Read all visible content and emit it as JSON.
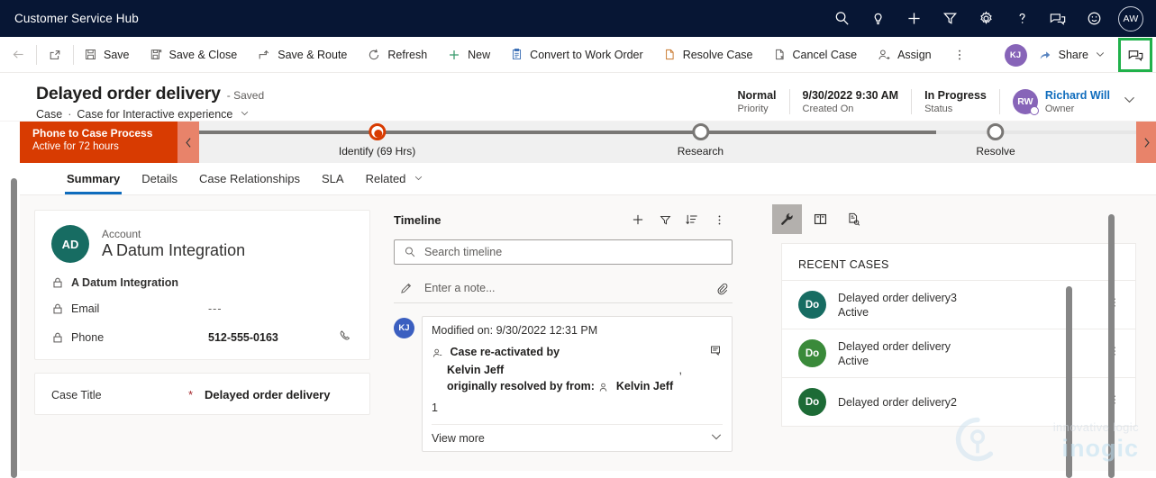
{
  "appbar": {
    "title": "Customer Service Hub",
    "icons": [
      "search-icon",
      "lightbulb-icon",
      "plus-icon",
      "filter-icon",
      "gear-icon",
      "help-icon",
      "feedback-icon",
      "smiley-icon"
    ],
    "avatar_initials": "AW"
  },
  "commandbar": {
    "back_label": "Back",
    "popout_label": "Open in new window",
    "items": [
      {
        "label": "Save",
        "icon": "save-icon"
      },
      {
        "label": "Save & Close",
        "icon": "save-close-icon"
      },
      {
        "label": "Save & Route",
        "icon": "save-route-icon"
      },
      {
        "label": "Refresh",
        "icon": "refresh-icon"
      },
      {
        "label": "New",
        "icon": "plus-icon"
      },
      {
        "label": "Convert to Work Order",
        "icon": "clipboard-icon"
      },
      {
        "label": "Resolve Case",
        "icon": "page-icon"
      },
      {
        "label": "Cancel Case",
        "icon": "page-x-icon"
      },
      {
        "label": "Assign",
        "icon": "person-assign-icon"
      }
    ],
    "overflow_label": "More commands",
    "user_initials": "KJ",
    "share_label": "Share",
    "highlighted_icon": "feedback-icon",
    "highlight_color": "#20b14a"
  },
  "record": {
    "title": "Delayed order delivery",
    "saved_state": "- Saved",
    "entity": "Case",
    "separator": "·",
    "form_name": "Case for Interactive experience",
    "fields": [
      {
        "value": "Normal",
        "label": "Priority"
      },
      {
        "value": "9/30/2022 9:30 AM",
        "label": "Created On"
      },
      {
        "value": "In Progress",
        "label": "Status"
      }
    ],
    "owner": {
      "initials": "RW",
      "name": "Richard Will",
      "label": "Owner"
    }
  },
  "bpf": {
    "name": "Phone to Case Process",
    "active_for": "Active for 72 hours",
    "prev_label": "Previous stage",
    "next_label": "Next stage",
    "stages": [
      {
        "label": "Identify",
        "duration": "(69 Hrs)",
        "active": true
      },
      {
        "label": "Research",
        "duration": "",
        "active": false
      },
      {
        "label": "Resolve",
        "duration": "",
        "active": false
      }
    ]
  },
  "tabs": [
    {
      "label": "Summary",
      "selected": true
    },
    {
      "label": "Details",
      "selected": false
    },
    {
      "label": "Case Relationships",
      "selected": false
    },
    {
      "label": "SLA",
      "selected": false
    },
    {
      "label": "Related",
      "selected": false,
      "has_caret": true
    }
  ],
  "account_card": {
    "initials": "AD",
    "kind": "Account",
    "name": "A Datum Integration",
    "rows": [
      {
        "label": "A Datum Integration",
        "value": "",
        "strong_label": true
      },
      {
        "label": "Email",
        "value": "---",
        "dim": true
      },
      {
        "label": "Phone",
        "value": "512-555-0163",
        "call_icon": "phone-icon"
      }
    ]
  },
  "case_title_field": {
    "label": "Case Title",
    "required": "*",
    "value": "Delayed order delivery"
  },
  "timeline": {
    "title": "Timeline",
    "actions": [
      "plus-icon",
      "filter-icon",
      "sort-icon",
      "more-icon"
    ],
    "search_placeholder": "Search timeline",
    "note_placeholder": "Enter a note...",
    "attach_icon": "paperclip-icon",
    "entry": {
      "initials": "KJ",
      "modified_on": "Modified on: 9/30/2022 12:31 PM",
      "line1": "Case re-activated by",
      "line2": "Kelvin Jeff",
      "line2_suffix": ",",
      "line3_prefix": "originally resolved by from:",
      "line3_person": "Kelvin Jeff",
      "count": "1",
      "view_more": "View more",
      "record_icon": "note-record-icon"
    }
  },
  "right_panel": {
    "tabs": [
      {
        "icon": "wrench-icon",
        "selected": true
      },
      {
        "icon": "knowledge-book-icon",
        "selected": false
      },
      {
        "icon": "similar-records-icon",
        "selected": false
      }
    ],
    "section_title": "RECENT CASES",
    "cases": [
      {
        "initials": "Do",
        "name": "Delayed order delivery3",
        "state": "Active",
        "color": "#176c62"
      },
      {
        "initials": "Do",
        "name": "Delayed order delivery",
        "state": "Active",
        "color": "#3a8a3a"
      },
      {
        "initials": "Do",
        "name": "Delayed order delivery2",
        "state": "",
        "color": "#1d6b36"
      }
    ]
  },
  "watermark": {
    "tagline": "innovative logic",
    "brand": "inogic"
  }
}
